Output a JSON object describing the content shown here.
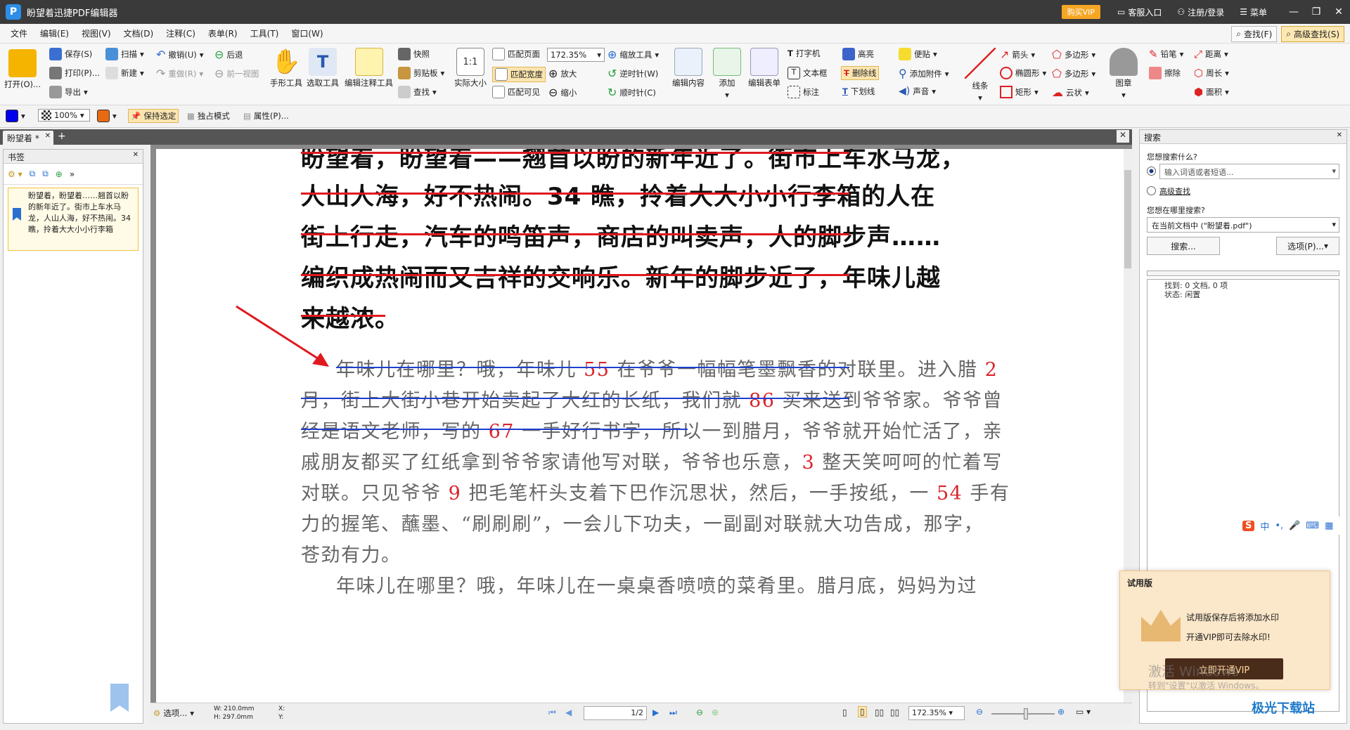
{
  "app": {
    "title": "盼望着迅捷PDF编辑器",
    "vip": "购买VIP",
    "support": "客服入口",
    "login": "注册/登录",
    "menu": "菜单"
  },
  "menus": [
    "文件",
    "编辑(E)",
    "视图(V)",
    "文档(D)",
    "注释(C)",
    "表单(R)",
    "工具(T)",
    "窗口(W)"
  ],
  "find": {
    "find": "查找(F)",
    "advanced": "高级查找(S)"
  },
  "ribbon": {
    "open": "打开(O)...",
    "save": "保存(S)",
    "print": "打印(P)...",
    "export": "导出",
    "scan": "扫描",
    "new": "新建",
    "undo": "撤销(U)",
    "redo": "重做(R)",
    "back": "后退",
    "prev_view": "前一视图",
    "hand": "手形工具",
    "select": "选取工具",
    "edit_annot": "编辑注释工具",
    "snapshot": "快照",
    "clipboard": "剪贴板",
    "search": "查找",
    "actual": "实际大小",
    "fit_page": "匹配页面",
    "fit_width": "匹配宽度",
    "fit_visible": "匹配可见",
    "zoom_value": "172.35%",
    "zoom_in": "放大",
    "zoom_out": "缩小",
    "zoom_tool": "缩放工具",
    "rot_ccw": "逆时针(W)",
    "rot_cw": "顺时针(C)",
    "edit_content": "编辑内容",
    "add": "添加",
    "edit_form": "编辑表单",
    "typewriter": "打字机",
    "textbox": "文本框",
    "callout": "标注",
    "highlight": "高亮",
    "strike": "删除线",
    "underline": "下划线",
    "note": "便贴",
    "attach": "添加附件",
    "sound": "声音",
    "lines": "线条",
    "arrow": "箭头",
    "ellipse": "椭圆形",
    "rect": "矩形",
    "polygon": "多边形",
    "polyline": "多边形",
    "cloud": "云状",
    "stamp": "图章",
    "pencil": "铅笔",
    "eraser": "擦除",
    "distance": "距离",
    "perimeter": "周长",
    "area": "面积"
  },
  "format": {
    "opacity": "100%",
    "keep": "保持选定",
    "exclusive": "独占模式",
    "props": "属性(P)..."
  },
  "tab": {
    "name": "盼望着 *"
  },
  "bookmarks": {
    "title": "书签",
    "item": "盼望着，盼望着……翘首以盼的新年近了。街市上车水马龙，人山人海，好不热闹。34瞧，拎着大大小小行李箱"
  },
  "doc": {
    "b0": "盼望着，盼望着——翘首以盼的新年近了。街市上车水马龙，",
    "b1": "人山人海，好不热闹。34 瞧，拎着大大小小行李箱的人在",
    "b2": "街上行走，汽车的鸣笛声，商店的叫卖声，人的脚步声……",
    "b3": "编织成热闹而又吉祥的交响乐。新年的脚步近了，年味儿越",
    "b4": "来越浓。",
    "p1a": "年味儿在哪里？哦，年味儿 ",
    "n55": "55",
    " p1b": "",
    "p1c": " 在爷爷一幅幅笔墨飘香的对联里。进入腊 ",
    "n2": "2",
    "p2a": "月，街上大街小巷开始卖起了大红的长纸，我们就 ",
    "n86": "86",
    "p2b": " 买来送到爷爷家。爷爷曾",
    "p3a": "经是语文老师，写的 ",
    "n67": "67",
    "p3b": " 一手好行书字，所以一到腊月，爷爷就开始忙活了，亲",
    "p4a": "戚朋友都买了红纸拿到爷爷家请他写对联，爷爷也乐意，",
    "n3": "3",
    "p4b": " 整天笑呵呵的忙着写",
    "p5a": "对联。只见爷爷 ",
    "n9": "9",
    "p5b": " 把毛笔杆头支着下巴作沉思状，然后，一手按纸，一 ",
    "n54": "54",
    "p5c": " 手有",
    "p6": "力的握笔、蘸墨、“刷刷刷”，一会儿下功夫，一副副对联就大功告成，那字，",
    "p7": "苍劲有力。",
    "p8": "年味儿在哪里？哦，年味儿在一桌桌香喷喷的菜肴里。腊月底，妈妈为过"
  },
  "status": {
    "options": "选项...",
    "w": "W: 210.0mm",
    "h": "H: 297.0mm",
    "x": "X:",
    "y": "Y:",
    "page": "1",
    "pages": "/2",
    "zoom": "172.35%"
  },
  "search": {
    "title": "搜索",
    "q": "您想搜索什么?",
    "placeholder": "输入词语或者短语...",
    "advanced": "高级查找",
    "where": "您想在哪里搜索?",
    "scope": "在当前文档中 (\"盼望着.pdf\")",
    "search_btn": "搜索...",
    "options_btn": "选项(P)...",
    "found": "找到: 0 文档, 0 项",
    "state": "状态: 闲置"
  },
  "trial": {
    "title": "试用版",
    "line1": "试用版保存后将添加水印",
    "line2": "开通VIP即可去除水印!",
    "cta": "立即开通VIP",
    "activate": "激活 Windows",
    "activate_sub": "转到\"设置\"以激活 Windows。"
  },
  "watermark": "极光下载站"
}
